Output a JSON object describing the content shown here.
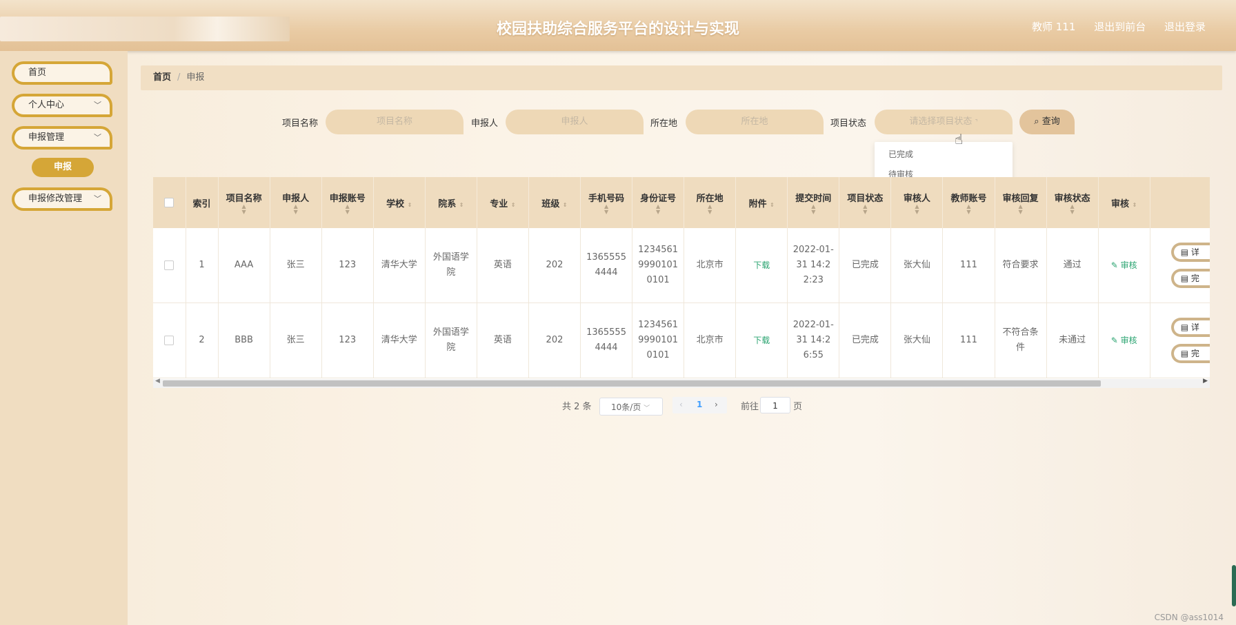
{
  "header": {
    "title": "校园扶助综合服务平台的设计与实现",
    "user": "教师 111",
    "front_link": "退出到前台",
    "logout_link": "退出登录"
  },
  "sidebar": {
    "items": [
      {
        "label": "首页"
      },
      {
        "label": "个人中心"
      },
      {
        "label": "申报管理"
      },
      {
        "label": "申报修改管理"
      }
    ],
    "active_sub": "申报"
  },
  "breadcrumb": {
    "home": "首页",
    "current": "申报"
  },
  "search": {
    "name_label": "项目名称",
    "name_placeholder": "项目名称",
    "applicant_label": "申报人",
    "applicant_placeholder": "申报人",
    "location_label": "所在地",
    "location_placeholder": "所在地",
    "status_label": "项目状态",
    "status_placeholder": "请选择项目状态",
    "query_button": "查询",
    "status_options": [
      "已完成",
      "待审核"
    ]
  },
  "table": {
    "headers": [
      "索引",
      "项目名称",
      "申报人",
      "申报账号",
      "学校",
      "院系",
      "专业",
      "班级",
      "手机号码",
      "身份证号",
      "所在地",
      "附件",
      "提交时间",
      "项目状态",
      "审核人",
      "教师账号",
      "审核回复",
      "审核状态",
      "审核"
    ],
    "rows": [
      {
        "index": "1",
        "project": "AAA",
        "applicant": "张三",
        "account": "123",
        "school": "清华大学",
        "dept": "外国语学院",
        "major": "英语",
        "class": "202",
        "phone": "13655554444",
        "idcard": "123456199901010101",
        "location": "北京市",
        "attachment": "下载",
        "time": "2022-01-31 14:22:23",
        "pstatus": "已完成",
        "reviewer": "张大仙",
        "teacher": "111",
        "reply": "符合要求",
        "rstatus": "通过",
        "audit": "审核",
        "op1": "详",
        "op2": "完"
      },
      {
        "index": "2",
        "project": "BBB",
        "applicant": "张三",
        "account": "123",
        "school": "清华大学",
        "dept": "外国语学院",
        "major": "英语",
        "class": "202",
        "phone": "13655554444",
        "idcard": "123456199901010101",
        "location": "北京市",
        "attachment": "下载",
        "time": "2022-01-31 14:26:55",
        "pstatus": "已完成",
        "reviewer": "张大仙",
        "teacher": "111",
        "reply": "不符合条件",
        "rstatus": "未通过",
        "audit": "审核",
        "op1": "详",
        "op2": "完"
      }
    ]
  },
  "pagination": {
    "total": "共 2 条",
    "page_size": "10条/页",
    "current_page": "1",
    "goto_label": "前往",
    "goto_value": "1",
    "page_suffix": "页"
  },
  "watermark": "CSDN @ass1014",
  "colors": {
    "accent": "#d5a637",
    "header": "#e9cba4",
    "sidebar": "#f0ddc1",
    "link": "#2ba471"
  }
}
